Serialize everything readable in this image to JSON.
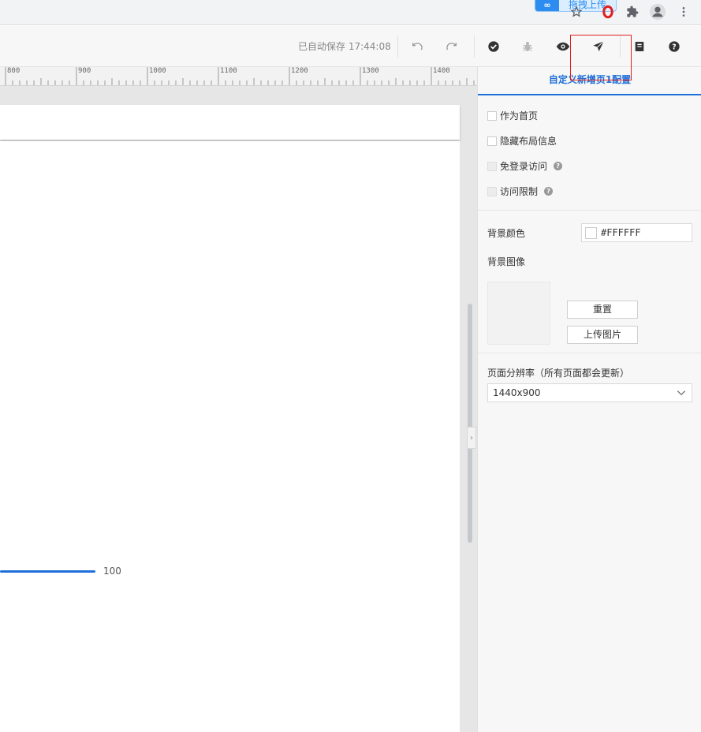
{
  "chrome": {
    "extension_badge": "拖拽上传",
    "icons": [
      "infinity-logo-icon",
      "star-icon",
      "opera-icon",
      "puzzle-icon",
      "profile-icon",
      "kebab-menu-icon"
    ]
  },
  "toolbar": {
    "autosave_text": "已自动保存 17:44:08",
    "icons": [
      "undo-icon",
      "redo-icon",
      "check-circle-icon",
      "bug-icon",
      "eye-icon",
      "send-icon",
      "document-icon",
      "help-icon"
    ]
  },
  "ruler": {
    "labels": [
      "800",
      "900",
      "1000",
      "1100",
      "1200",
      "1300",
      "1400"
    ]
  },
  "canvas": {
    "slider_value": "100"
  },
  "panel": {
    "title": "自定义新增页1配置",
    "checkboxes": [
      {
        "label": "作为首页",
        "disabled": false,
        "help": false
      },
      {
        "label": "隐藏布局信息",
        "disabled": false,
        "help": false
      },
      {
        "label": "免登录访问",
        "disabled": true,
        "help": true
      },
      {
        "label": "访问限制",
        "disabled": true,
        "help": true
      }
    ],
    "bg_color_label": "背景颜色",
    "bg_color_value": "#FFFFFF",
    "bg_image_label": "背景图像",
    "reset_button": "重置",
    "upload_button": "上传图片",
    "resolution_label": "页面分辨率（所有页面都会更新）",
    "resolution_value": "1440x900"
  }
}
